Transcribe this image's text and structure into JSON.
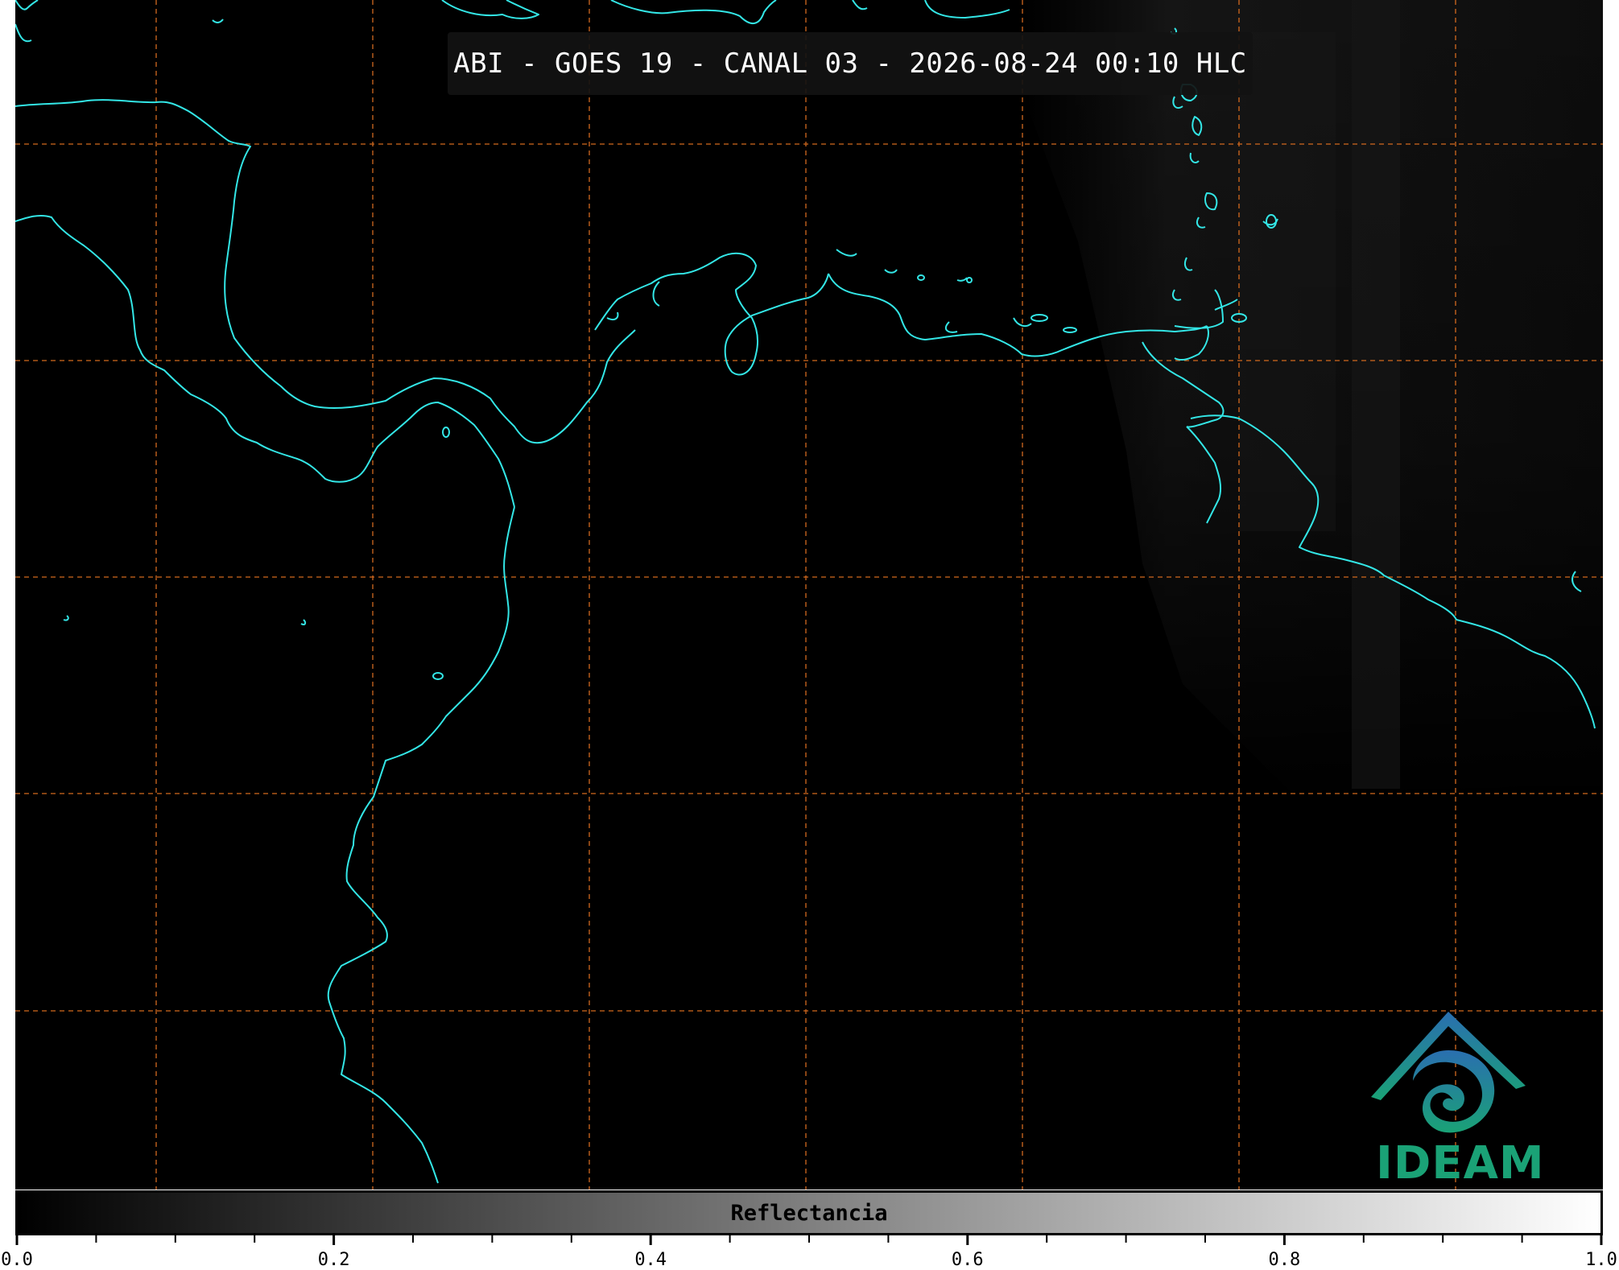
{
  "title": "ABI - GOES 19 - CANAL 03 - 2026-08-24 00:10 HLC",
  "logo": {
    "text": "IDEAM"
  },
  "colorbar": {
    "label": "Reflectancia",
    "min": 0.0,
    "max": 1.0,
    "tick_labels": [
      "0.0",
      "0.2",
      "0.4",
      "0.6",
      "0.8",
      "1.0"
    ],
    "tick_values": [
      0.0,
      0.2,
      0.4,
      0.6,
      0.8,
      1.0
    ],
    "minor_tick_step": 0.05,
    "colormap": [
      "#000000",
      "#ffffff"
    ]
  },
  "colors": {
    "background": "#000000",
    "coastline": "#33e6e6",
    "gridline": "#d2691e",
    "logo_green": "#1aa276",
    "logo_blue": "#2a6fb0"
  }
}
